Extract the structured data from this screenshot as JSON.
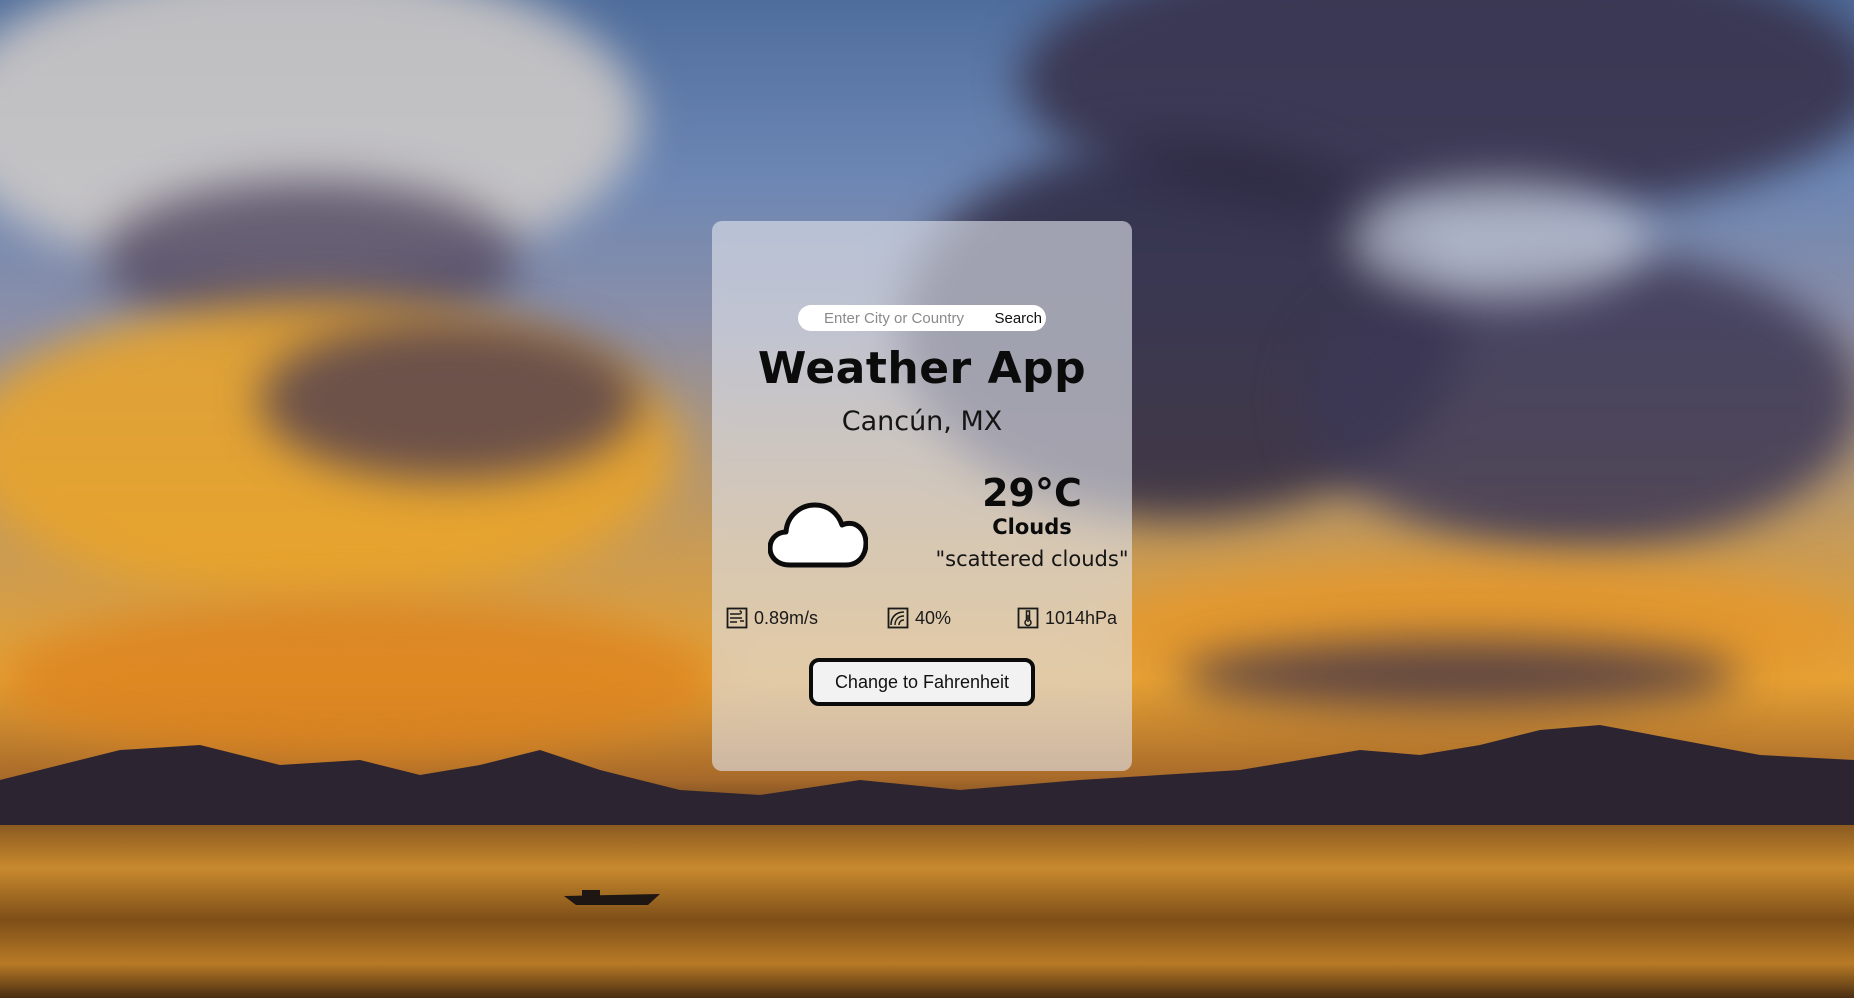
{
  "search": {
    "placeholder": "Enter City or Country",
    "button_label": "Search"
  },
  "app": {
    "title": "Weather App"
  },
  "weather": {
    "location": "Cancún, MX",
    "temperature": "29°C",
    "condition": "Clouds",
    "description": "\"scattered clouds\"",
    "icon": "cloud-icon"
  },
  "stats": {
    "wind": {
      "value": "0.89m/s",
      "icon": "wind-icon"
    },
    "humidity": {
      "value": "40%",
      "icon": "humidity-icon"
    },
    "pressure": {
      "value": "1014hPa",
      "icon": "thermometer-icon"
    }
  },
  "controls": {
    "unit_toggle_label": "Change to Fahrenheit"
  },
  "colors": {
    "card_background": "#e1e4ec",
    "text": "#0b0b0b",
    "button_border": "#0b0b0b",
    "button_background": "#f2f2f2"
  }
}
